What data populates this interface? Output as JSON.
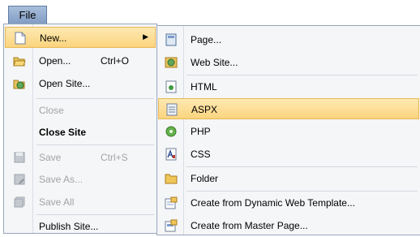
{
  "file_tab": {
    "label": "File"
  },
  "menu": {
    "new": "New...",
    "open": "Open...",
    "open_shortcut": "Ctrl+O",
    "open_site": "Open Site...",
    "close": "Close",
    "close_site": "Close Site",
    "save": "Save",
    "save_shortcut": "Ctrl+S",
    "save_as": "Save As...",
    "save_all": "Save All",
    "publish_site": "Publish Site..."
  },
  "submenu": {
    "page": "Page...",
    "web_site": "Web Site...",
    "html": "HTML",
    "aspx": "ASPX",
    "php": "PHP",
    "css": "CSS",
    "folder": "Folder",
    "create_dwt": "Create from Dynamic Web Template...",
    "create_master": "Create from Master Page..."
  },
  "colors": {
    "highlight": "#fbd47e",
    "menu_bg": "#f5f6f8",
    "disabled_text": "#a3a3a3"
  }
}
